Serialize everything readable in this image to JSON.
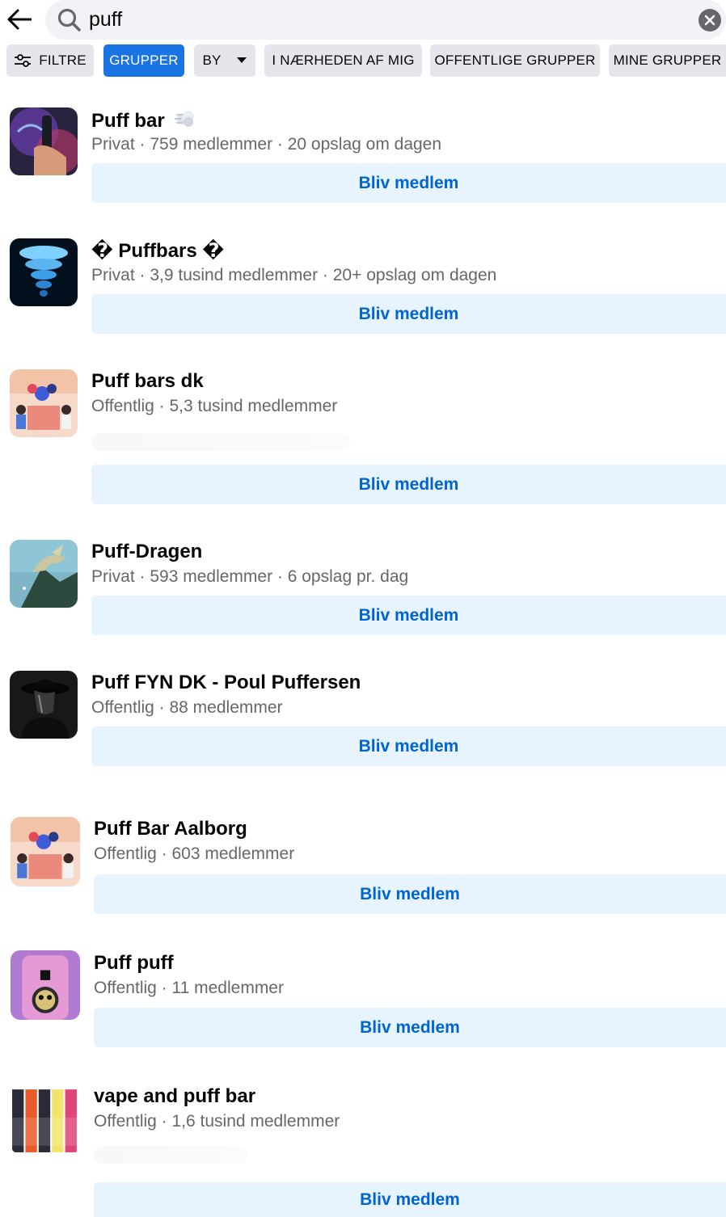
{
  "search": {
    "value": "puff",
    "placeholder": "Søg"
  },
  "filters": [
    {
      "label": "FILTRE",
      "active": false
    },
    {
      "label": "GRUPPER",
      "active": true
    },
    {
      "label": "BY",
      "active": false
    },
    {
      "label": "I NÆRHEDEN AF MIG",
      "active": false
    },
    {
      "label": "OFFENTLIGE GRUPPER",
      "active": false
    },
    {
      "label": "MINE GRUPPER",
      "active": false
    }
  ],
  "colors": {
    "accent": "#1b74e4",
    "join_bg": "#e7f3ff",
    "join_text": "#0064d1",
    "meta_text": "#65676b",
    "chip_bg": "#e4e6eb"
  },
  "groups": [
    {
      "name": "Puff bar",
      "meta": "Privat · 759 medlemmer · 20 opslag om dagen",
      "join": "Bliv medlem",
      "emoji_icon": "dash-icon"
    },
    {
      "name": "� Puffbars �",
      "meta": "Privat · 3,9 tusind medlemmer · 20+ opslag om dagen",
      "join": "Bliv medlem"
    },
    {
      "name": "Puff bars dk",
      "meta": "Offentlig · 5,3 tusind medlemmer",
      "join": "Bliv medlem"
    },
    {
      "name": "Puff-Dragen",
      "meta": "Privat · 593 medlemmer · 6 opslag pr. dag",
      "join": "Bliv medlem"
    },
    {
      "name": "Puff FYN DK - Poul Puffersen",
      "meta": "Offentlig · 88 medlemmer",
      "join": "Bliv medlem"
    },
    {
      "name": "Puff Bar Aalborg",
      "meta": "Offentlig · 603 medlemmer",
      "join": "Bliv medlem"
    },
    {
      "name": "Puff puff",
      "meta": "Offentlig · 11 medlemmer",
      "join": "Bliv medlem"
    },
    {
      "name": "vape and puff bar",
      "meta": "Offentlig · 1,6 tusind medlemmer",
      "join": "Bliv medlem"
    }
  ]
}
